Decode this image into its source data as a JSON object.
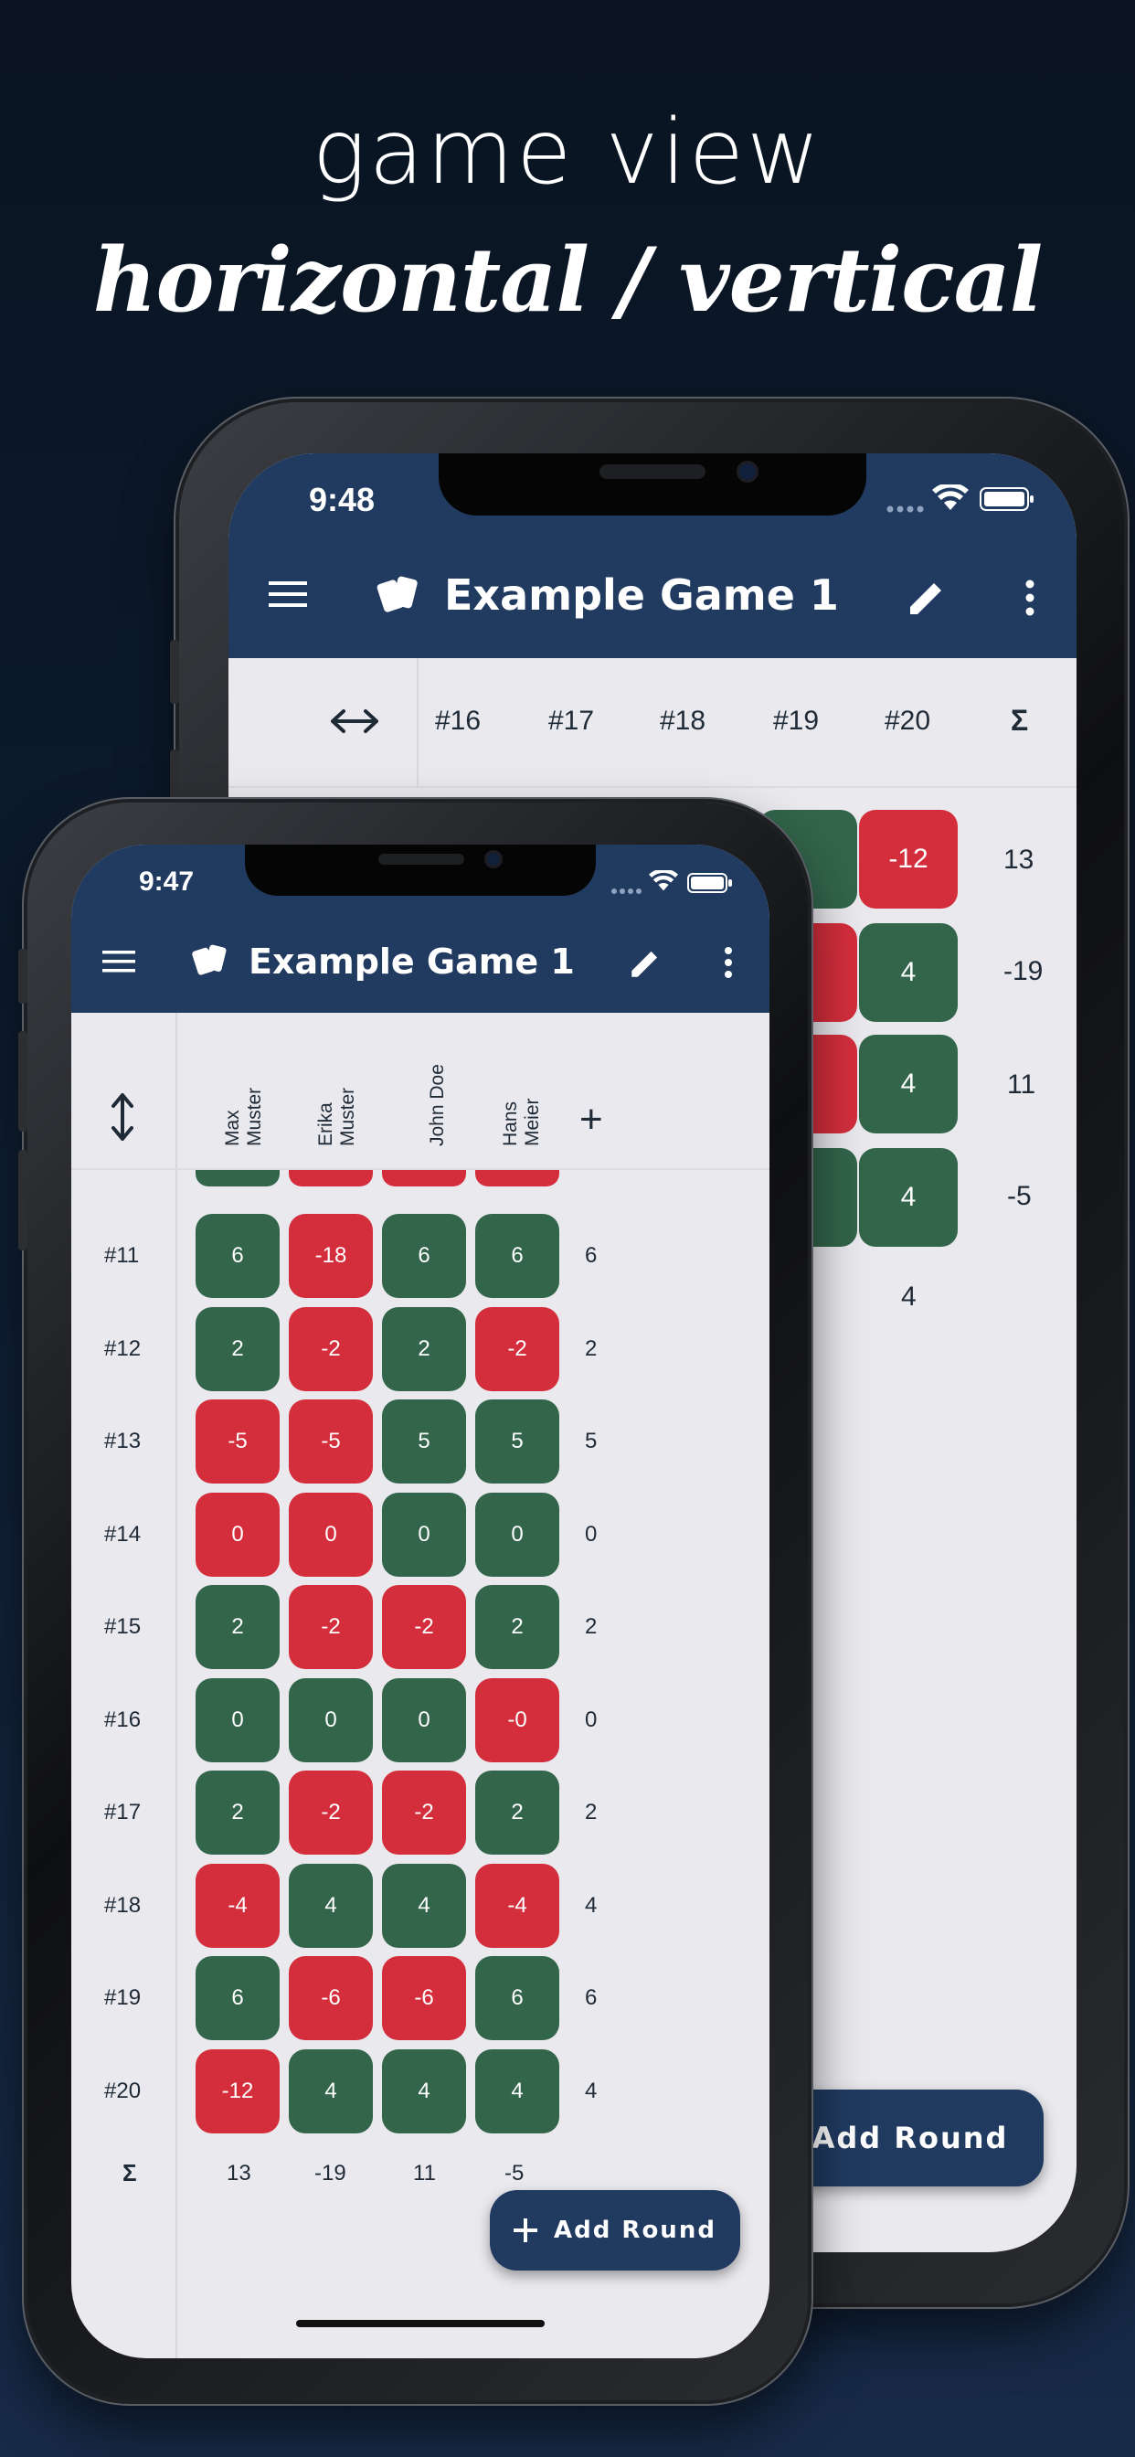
{
  "heading": {
    "line1": "game view",
    "line2": "horizontal / vertical"
  },
  "back_phone": {
    "status_time": "9:48",
    "app_title": "Example Game 1",
    "header": {
      "toggle_icon": "horizontal-arrows-icon",
      "rounds": [
        "#16",
        "#17",
        "#18",
        "#19",
        "#20"
      ],
      "sum_label": "Σ"
    },
    "rows": [
      {
        "r19": "",
        "r20": "-12",
        "r20_color": "red",
        "sum": "13"
      },
      {
        "r19": "",
        "r20": "4",
        "r20_color": "green",
        "sum": "-19"
      },
      {
        "r19": "",
        "r20": "4",
        "r20_color": "green",
        "sum": "11"
      },
      {
        "r19": "",
        "r20": "4",
        "r20_color": "green",
        "sum": "-5"
      }
    ],
    "round_sum_20": "4",
    "add_round_label": "Add Round"
  },
  "front_phone": {
    "status_time": "9:47",
    "app_title": "Example Game 1",
    "toggle_icon": "vertical-arrows-icon",
    "players": [
      "Max\nMuster",
      "Erika\nMuster",
      "John Doe",
      "Hans\nMeier"
    ],
    "add_player_label": "+",
    "rounds": [
      {
        "label": "#11",
        "scores": [
          "6",
          "-18",
          "6",
          "6"
        ],
        "colors": [
          "g",
          "r",
          "g",
          "g"
        ],
        "best": "6"
      },
      {
        "label": "#12",
        "scores": [
          "2",
          "-2",
          "2",
          "-2"
        ],
        "colors": [
          "g",
          "r",
          "g",
          "r"
        ],
        "best": "2"
      },
      {
        "label": "#13",
        "scores": [
          "-5",
          "-5",
          "5",
          "5"
        ],
        "colors": [
          "r",
          "r",
          "g",
          "g"
        ],
        "best": "5"
      },
      {
        "label": "#14",
        "scores": [
          "0",
          "0",
          "0",
          "0"
        ],
        "colors": [
          "r",
          "r",
          "g",
          "g"
        ],
        "best": "0"
      },
      {
        "label": "#15",
        "scores": [
          "2",
          "-2",
          "-2",
          "2"
        ],
        "colors": [
          "g",
          "r",
          "r",
          "g"
        ],
        "best": "2"
      },
      {
        "label": "#16",
        "scores": [
          "0",
          "0",
          "0",
          "-0"
        ],
        "colors": [
          "g",
          "g",
          "g",
          "r"
        ],
        "best": "0"
      },
      {
        "label": "#17",
        "scores": [
          "2",
          "-2",
          "-2",
          "2"
        ],
        "colors": [
          "g",
          "r",
          "r",
          "g"
        ],
        "best": "2"
      },
      {
        "label": "#18",
        "scores": [
          "-4",
          "4",
          "4",
          "-4"
        ],
        "colors": [
          "r",
          "g",
          "g",
          "r"
        ],
        "best": "4"
      },
      {
        "label": "#19",
        "scores": [
          "6",
          "-6",
          "-6",
          "6"
        ],
        "colors": [
          "g",
          "r",
          "r",
          "g"
        ],
        "best": "6"
      },
      {
        "label": "#20",
        "scores": [
          "-12",
          "4",
          "4",
          "4"
        ],
        "colors": [
          "r",
          "g",
          "g",
          "g"
        ],
        "best": "4"
      }
    ],
    "sum_label": "Σ",
    "totals": [
      "13",
      "-19",
      "11",
      "-5"
    ],
    "add_round_label": "Add Round",
    "add_round_icon": "plus-icon"
  },
  "colors": {
    "app_bar": "#203a60",
    "positive": "#32654a",
    "negative": "#d42e3c",
    "background": "#e9e9ee"
  }
}
